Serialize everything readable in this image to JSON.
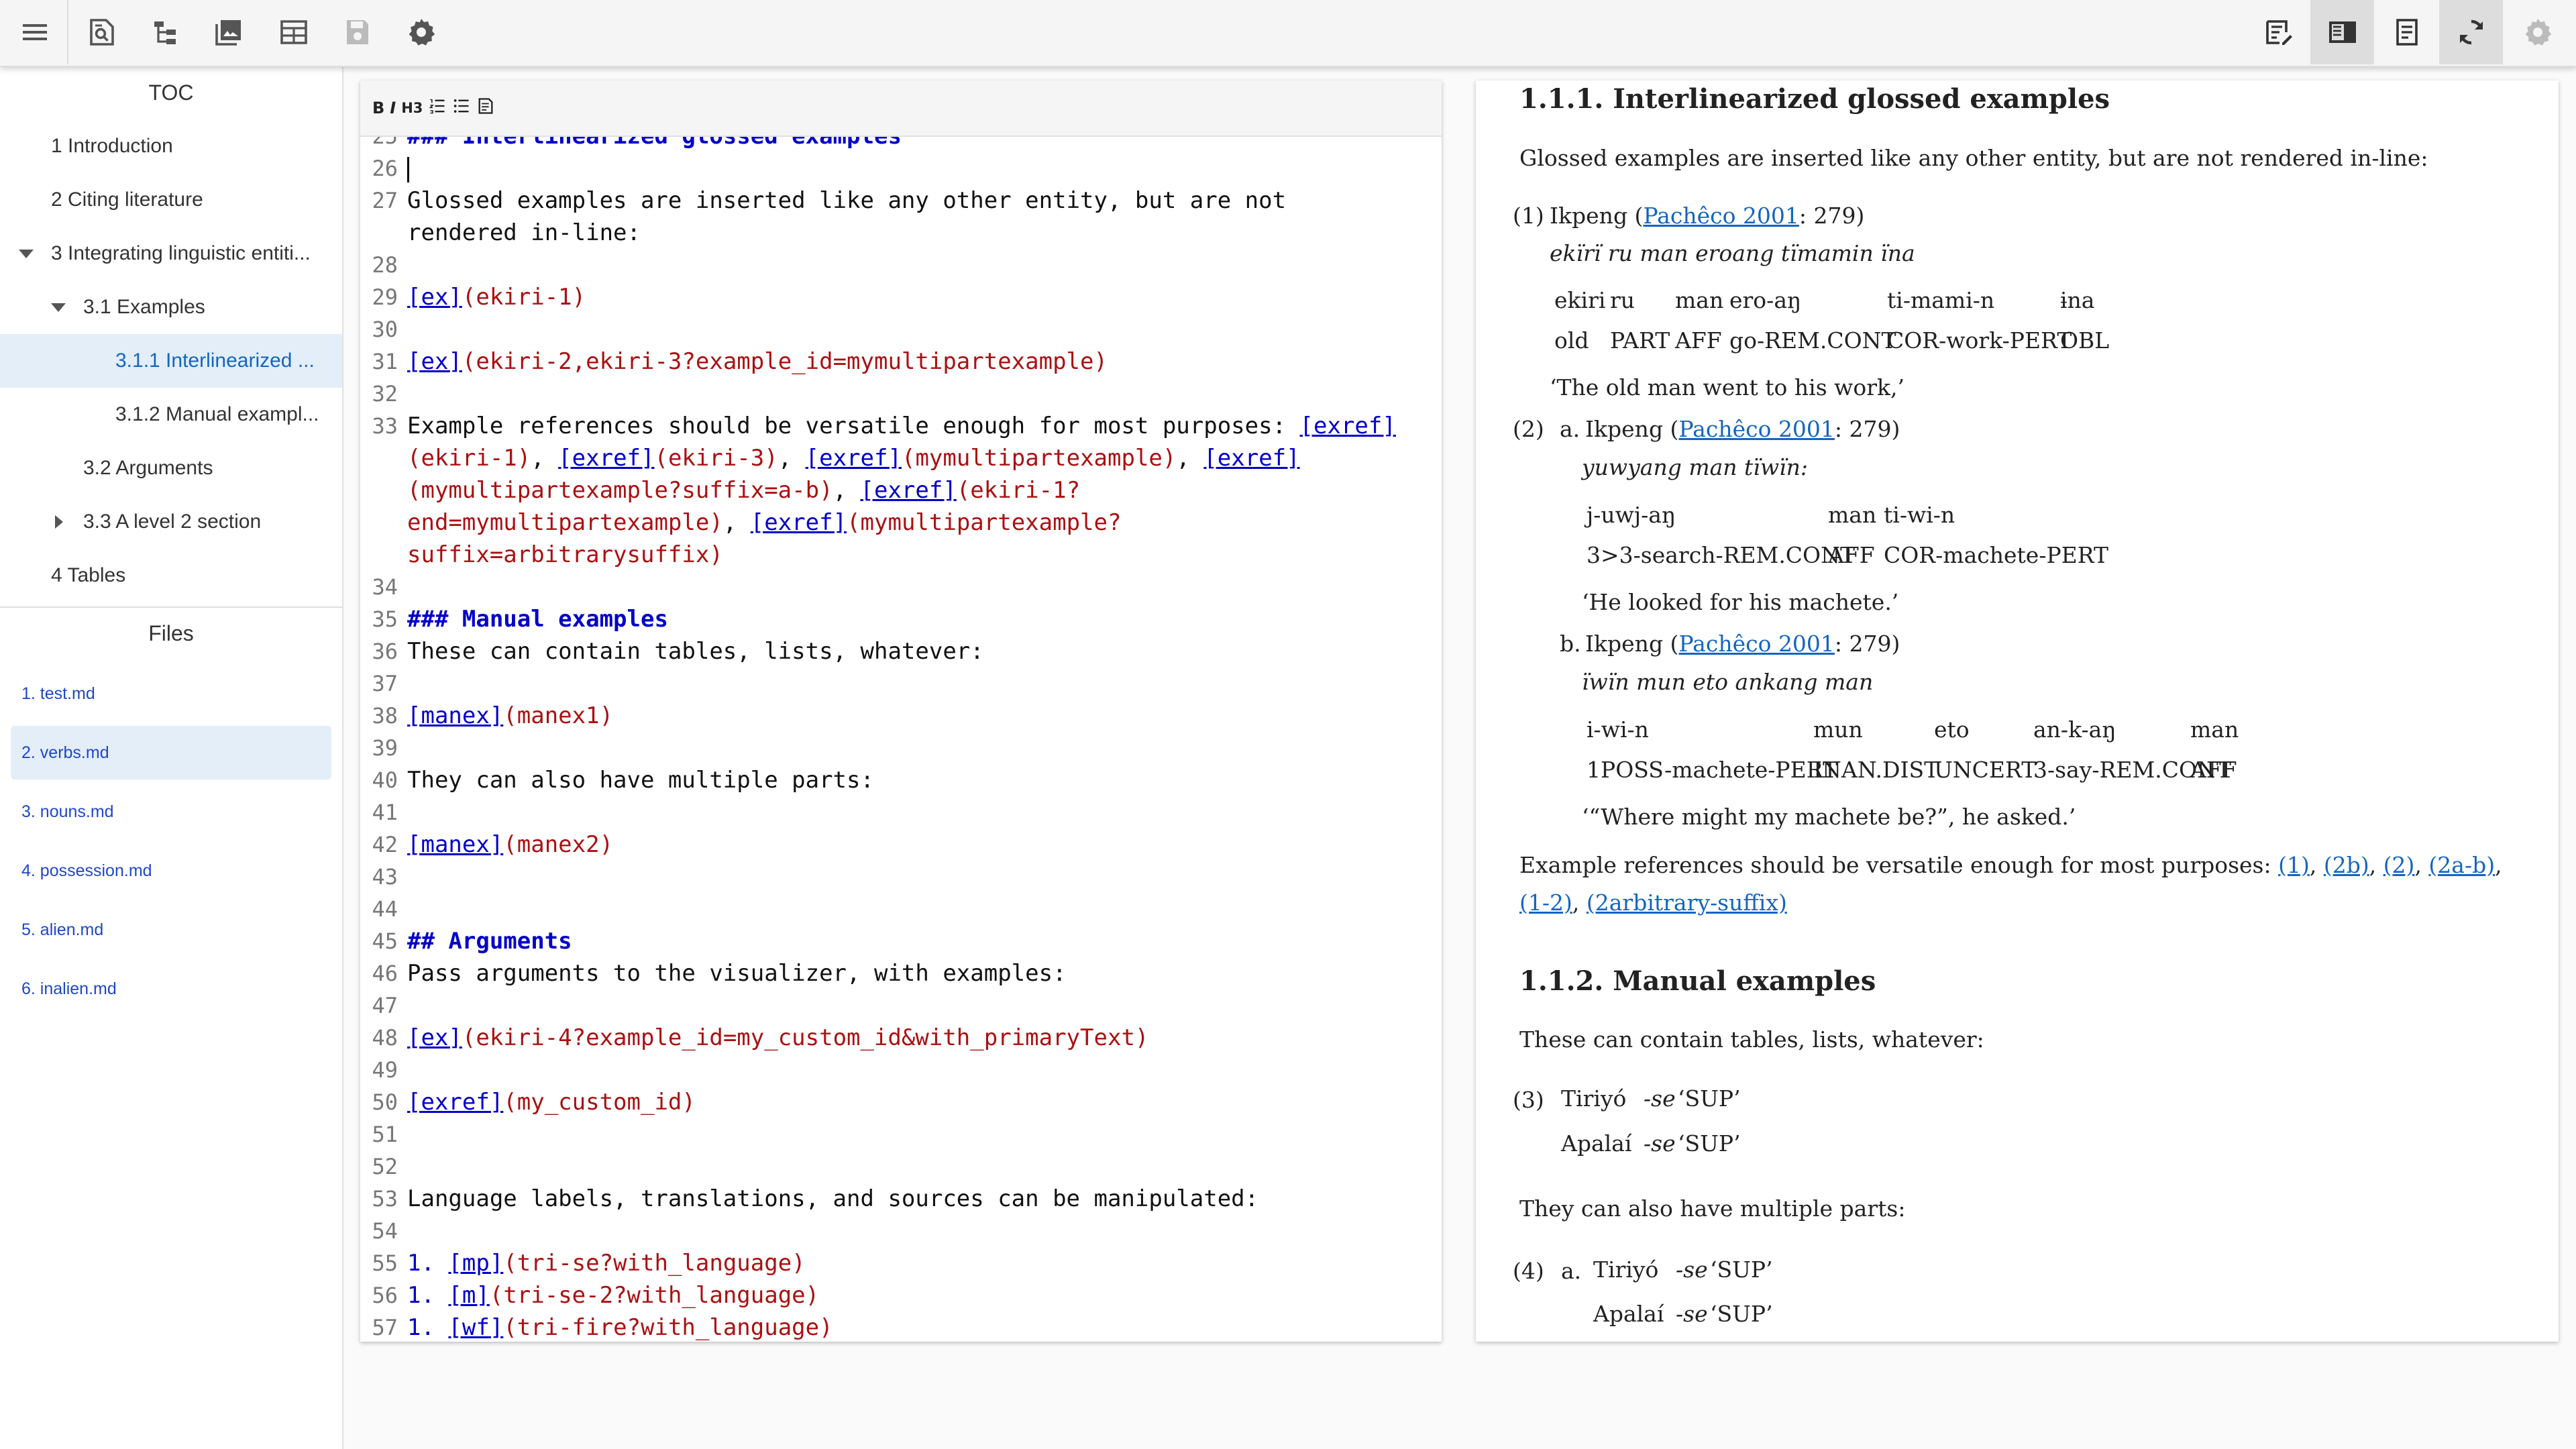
{
  "toolbar": {
    "left_icons": [
      "menu-icon",
      "find-in-page-icon",
      "tree-icon",
      "images-icon",
      "table-icon",
      "save-icon",
      "settings-icon"
    ],
    "right_icons": [
      "edit-note-icon",
      "split-view-icon",
      "document-icon",
      "sync-icon",
      "settings-icon"
    ]
  },
  "sidebar": {
    "toc_title": "TOC",
    "toc": [
      {
        "label": "1 Introduction"
      },
      {
        "label": "2 Citing literature"
      },
      {
        "label": "3 Integrating linguistic entiti..."
      },
      {
        "label": "3.1 Examples"
      },
      {
        "label": "3.1.1 Interlinearized ..."
      },
      {
        "label": "3.1.2 Manual exampl..."
      },
      {
        "label": "3.2 Arguments"
      },
      {
        "label": "3.3 A level 2 section"
      },
      {
        "label": "4 Tables"
      }
    ],
    "files_title": "Files",
    "files": [
      {
        "label": "1. test.md"
      },
      {
        "label": "2. verbs.md"
      },
      {
        "label": "3. nouns.md"
      },
      {
        "label": "4. possession.md"
      },
      {
        "label": "5. alien.md"
      },
      {
        "label": "6. inalien.md"
      }
    ]
  },
  "editor": {
    "toolbar": {
      "bold": "B",
      "italic": "I",
      "h3": "H3"
    },
    "lines": [
      {
        "n": "25",
        "p": [
          {
            "t": "### Interlinearized glossed examples",
            "c": "hd"
          }
        ]
      },
      {
        "n": "26",
        "cursor": true,
        "p": []
      },
      {
        "n": "27",
        "p": [
          {
            "t": "Glossed examples are inserted like any other entity, but are not rendered in-line:",
            "c": ""
          }
        ]
      },
      {
        "n": "28",
        "p": []
      },
      {
        "n": "29",
        "p": [
          {
            "t": "[ex]",
            "c": "lk"
          },
          {
            "t": "(ekiri-1)",
            "c": "pr"
          }
        ]
      },
      {
        "n": "30",
        "p": []
      },
      {
        "n": "31",
        "p": [
          {
            "t": "[ex]",
            "c": "lk"
          },
          {
            "t": "(ekiri-2,ekiri-3?example_id=mymultipartexample)",
            "c": "pr"
          }
        ]
      },
      {
        "n": "32",
        "p": []
      },
      {
        "n": "33",
        "p": [
          {
            "t": "Example references should be versatile enough for most purposes: ",
            "c": ""
          },
          {
            "t": "[exref]",
            "c": "lk"
          },
          {
            "t": "(ekiri-1)",
            "c": "pr"
          },
          {
            "t": ", ",
            "c": ""
          },
          {
            "t": "[exref]",
            "c": "lk"
          },
          {
            "t": "(ekiri-3)",
            "c": "pr"
          },
          {
            "t": ", ",
            "c": ""
          },
          {
            "t": "[exref]",
            "c": "lk"
          },
          {
            "t": "(mymultipartexample)",
            "c": "pr"
          },
          {
            "t": ", ",
            "c": ""
          },
          {
            "t": "[exref]",
            "c": "lk"
          },
          {
            "t": "(mymultipartexample?suffix=a-b)",
            "c": "pr"
          },
          {
            "t": ", ",
            "c": ""
          },
          {
            "t": "[exref]",
            "c": "lk"
          },
          {
            "t": "(ekiri-1?end=mymultipartexample)",
            "c": "pr"
          },
          {
            "t": ", ",
            "c": ""
          },
          {
            "t": "[exref]",
            "c": "lk"
          },
          {
            "t": "(mymultipartexample?suffix=arbitrarysuffix)",
            "c": "pr"
          }
        ]
      },
      {
        "n": "34",
        "p": []
      },
      {
        "n": "35",
        "p": [
          {
            "t": "### Manual examples",
            "c": "hd"
          }
        ]
      },
      {
        "n": "36",
        "p": [
          {
            "t": "These can contain tables, lists, whatever:",
            "c": ""
          }
        ]
      },
      {
        "n": "37",
        "p": []
      },
      {
        "n": "38",
        "p": [
          {
            "t": "[manex]",
            "c": "lk"
          },
          {
            "t": "(manex1)",
            "c": "pr"
          }
        ]
      },
      {
        "n": "39",
        "p": []
      },
      {
        "n": "40",
        "p": [
          {
            "t": "They can also have multiple parts:",
            "c": ""
          }
        ]
      },
      {
        "n": "41",
        "p": []
      },
      {
        "n": "42",
        "p": [
          {
            "t": "[manex]",
            "c": "lk"
          },
          {
            "t": "(manex2)",
            "c": "pr"
          }
        ]
      },
      {
        "n": "43",
        "p": []
      },
      {
        "n": "44",
        "p": []
      },
      {
        "n": "45",
        "p": [
          {
            "t": "## Arguments",
            "c": "hd"
          }
        ]
      },
      {
        "n": "46",
        "p": [
          {
            "t": "Pass arguments to the visualizer, with examples:",
            "c": ""
          }
        ]
      },
      {
        "n": "47",
        "p": []
      },
      {
        "n": "48",
        "p": [
          {
            "t": "[ex]",
            "c": "lk"
          },
          {
            "t": "(ekiri-4?example_id=my_custom_id&with_primaryText)",
            "c": "pr"
          }
        ]
      },
      {
        "n": "49",
        "p": []
      },
      {
        "n": "50",
        "p": [
          {
            "t": "[exref]",
            "c": "lk"
          },
          {
            "t": "(my_custom_id)",
            "c": "pr"
          }
        ]
      },
      {
        "n": "51",
        "p": []
      },
      {
        "n": "52",
        "p": []
      },
      {
        "n": "53",
        "p": [
          {
            "t": "Language labels, translations, and sources can be manipulated:",
            "c": ""
          }
        ]
      },
      {
        "n": "54",
        "p": []
      },
      {
        "n": "55",
        "p": [
          {
            "t": "1. ",
            "c": "lk-plain"
          },
          {
            "t": "[mp]",
            "c": "lk"
          },
          {
            "t": "(tri-se?with_language)",
            "c": "pr"
          }
        ]
      },
      {
        "n": "56",
        "p": [
          {
            "t": "1. ",
            "c": "lk-plain"
          },
          {
            "t": "[m]",
            "c": "lk"
          },
          {
            "t": "(tri-se-2?with_language)",
            "c": "pr"
          }
        ]
      },
      {
        "n": "57",
        "p": [
          {
            "t": "1. ",
            "c": "lk-plain"
          },
          {
            "t": "[wf]",
            "c": "lk"
          },
          {
            "t": "(tri-fire?with_language)",
            "c": "pr"
          }
        ]
      },
      {
        "n": "58",
        "p": []
      }
    ]
  },
  "preview": {
    "h1": "1.1.1. Interlinearized glossed examples",
    "p1": "Glossed examples are inserted like any other entity, but are not rendered in-line:",
    "ex1": {
      "num": "(1)",
      "lang": "Ikpeng (",
      "src": "Pachêco 2001",
      "page": ": 279)",
      "primary": "ekïrï ru man eroang tïmamin ïna",
      "words": [
        "ekiri",
        "ru",
        "man",
        "ero-aŋ",
        "ti-mami-n",
        "ɨna"
      ],
      "glosses": [
        "old",
        "PART",
        "AFF",
        "go-REM.CONT",
        "COR-work-PERT",
        "OBL"
      ],
      "trans": "‘The old man went to his work,’"
    },
    "ex2": {
      "num": "(2)",
      "a": {
        "label": "a.",
        "lang": "Ikpeng (",
        "src": "Pachêco 2001",
        "page": ": 279)",
        "primary": "yuwyang man tïwïn:",
        "words": [
          "j-uwj-aŋ",
          "man",
          "ti-wi-n"
        ],
        "glosses": [
          "3>3-search-REM.CONT",
          "AFF",
          "COR-machete-PERT"
        ],
        "trans": "‘He looked for his machete.’"
      },
      "b": {
        "label": "b.",
        "lang": "Ikpeng (",
        "src": "Pachêco 2001",
        "page": ": 279)",
        "primary": "ïwïn mun eto ankang man",
        "words": [
          "i-wi-n",
          "mun",
          "eto",
          "an-k-aŋ",
          "man"
        ],
        "glosses": [
          "1POSS-machete-PERT",
          "INAN.DIST",
          "UNCERT",
          "3-say-REM.CONT",
          "AFF"
        ],
        "trans": "‘“Where might my machete be?”, he asked.’"
      }
    },
    "refs_text": "Example references should be versatile enough for most purposes: ",
    "refs": [
      "(1)",
      "(2b)",
      "(2)",
      "(2a-b)",
      "(1-2)",
      "(2arbitrary-suffix)"
    ],
    "h2": "1.1.2. Manual examples",
    "p2": "These can contain tables, lists, whatever:",
    "ex3": {
      "num": "(3)",
      "rows": [
        {
          "lang": "Tiriyó",
          "form": "-se",
          "gloss": "‘SUP’"
        },
        {
          "lang": "Apalaí",
          "form": "-se",
          "gloss": "‘SUP’"
        }
      ]
    },
    "p3": "They can also have multiple parts:",
    "ex4": {
      "num": "(4)",
      "label": "a.",
      "rows": [
        {
          "lang": "Tiriyó",
          "form": "-se",
          "gloss": "‘SUP’"
        },
        {
          "lang": "Apalaí",
          "form": "-se",
          "gloss": "‘SUP’"
        }
      ]
    }
  }
}
